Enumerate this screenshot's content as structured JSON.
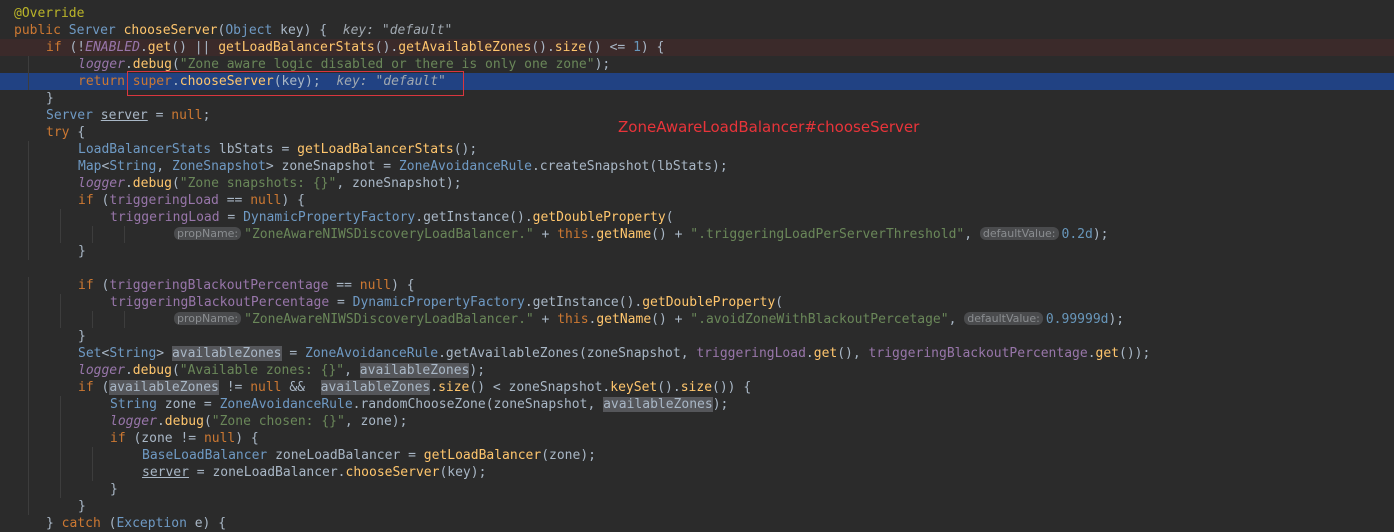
{
  "overlay": {
    "label": "ZoneAwareLoadBalancer#chooseServer"
  },
  "colors": {
    "background": "#2b2b2b",
    "current_line": "#214283",
    "error_line": "#3b2a2a",
    "annotation_red": "#e8343a"
  },
  "lines": [
    {
      "state": "",
      "indent": 0,
      "tokens": [
        {
          "t": "@Override",
          "c": "ann"
        }
      ]
    },
    {
      "state": "",
      "indent": 0,
      "tokens": [
        {
          "t": "public ",
          "c": "kw"
        },
        {
          "t": "Server ",
          "c": "cls"
        },
        {
          "t": "chooseServer",
          "c": "mth"
        },
        {
          "t": "(",
          "c": ""
        },
        {
          "t": "Object ",
          "c": "cls"
        },
        {
          "t": "key) {  ",
          "c": ""
        },
        {
          "t": "key: \"default\"",
          "c": "hint"
        }
      ]
    },
    {
      "state": "error",
      "indent": 1,
      "tokens": [
        {
          "t": "if ",
          "c": "kw"
        },
        {
          "t": "(!",
          "c": ""
        },
        {
          "t": "ENABLED",
          "c": "sfi"
        },
        {
          "t": ".",
          "c": ""
        },
        {
          "t": "get",
          "c": "mth"
        },
        {
          "t": "() || ",
          "c": ""
        },
        {
          "t": "getLoadBalancerStats",
          "c": "mth"
        },
        {
          "t": "().",
          "c": ""
        },
        {
          "t": "getAvailableZones",
          "c": "mth"
        },
        {
          "t": "().",
          "c": ""
        },
        {
          "t": "size",
          "c": "mth"
        },
        {
          "t": "() <= ",
          "c": ""
        },
        {
          "t": "1",
          "c": "num"
        },
        {
          "t": ") {",
          "c": ""
        }
      ]
    },
    {
      "state": "",
      "indent": 2,
      "tokens": [
        {
          "t": "logger",
          "c": "fldi"
        },
        {
          "t": ".",
          "c": ""
        },
        {
          "t": "debug",
          "c": "mth"
        },
        {
          "t": "(",
          "c": ""
        },
        {
          "t": "\"Zone aware logic disabled or there is only one zone\"",
          "c": "str"
        },
        {
          "t": ");",
          "c": ""
        }
      ]
    },
    {
      "state": "current",
      "indent": 2,
      "tokens": [
        {
          "t": "return ",
          "c": "kw"
        },
        {
          "t": "super",
          "c": "kw"
        },
        {
          "t": ".",
          "c": ""
        },
        {
          "t": "chooseServer",
          "c": "mth"
        },
        {
          "t": "(key);  ",
          "c": ""
        },
        {
          "t": "key: \"default\"",
          "c": "hint"
        }
      ]
    },
    {
      "state": "",
      "indent": 1,
      "tokens": [
        {
          "t": "}",
          "c": ""
        }
      ]
    },
    {
      "state": "",
      "indent": 1,
      "tokens": [
        {
          "t": "Server ",
          "c": "cls"
        },
        {
          "t": "server",
          "c": "ul"
        },
        {
          "t": " = ",
          "c": ""
        },
        {
          "t": "null",
          "c": "kw"
        },
        {
          "t": ";",
          "c": ""
        }
      ]
    },
    {
      "state": "",
      "indent": 1,
      "tokens": [
        {
          "t": "try ",
          "c": "kw"
        },
        {
          "t": "{",
          "c": ""
        }
      ]
    },
    {
      "state": "",
      "indent": 2,
      "tokens": [
        {
          "t": "LoadBalancerStats ",
          "c": "cls"
        },
        {
          "t": "lbStats = ",
          "c": ""
        },
        {
          "t": "getLoadBalancerStats",
          "c": "mth"
        },
        {
          "t": "();",
          "c": ""
        }
      ]
    },
    {
      "state": "",
      "indent": 2,
      "tokens": [
        {
          "t": "Map",
          "c": "cls"
        },
        {
          "t": "<",
          "c": ""
        },
        {
          "t": "String",
          "c": "cls"
        },
        {
          "t": ", ",
          "c": ""
        },
        {
          "t": "ZoneSnapshot",
          "c": "cls"
        },
        {
          "t": "> zoneSnapshot = ",
          "c": ""
        },
        {
          "t": "ZoneAvoidanceRule",
          "c": "cls"
        },
        {
          "t": ".createSnapshot(lbStats);",
          "c": ""
        }
      ]
    },
    {
      "state": "",
      "indent": 2,
      "tokens": [
        {
          "t": "logger",
          "c": "fldi"
        },
        {
          "t": ".",
          "c": ""
        },
        {
          "t": "debug",
          "c": "mth"
        },
        {
          "t": "(",
          "c": ""
        },
        {
          "t": "\"Zone snapshots: {}\"",
          "c": "str"
        },
        {
          "t": ", zoneSnapshot);",
          "c": ""
        }
      ]
    },
    {
      "state": "",
      "indent": 2,
      "tokens": [
        {
          "t": "if ",
          "c": "kw"
        },
        {
          "t": "(",
          "c": ""
        },
        {
          "t": "triggeringLoad",
          "c": "fld"
        },
        {
          "t": " == ",
          "c": ""
        },
        {
          "t": "null",
          "c": "kw"
        },
        {
          "t": ") {",
          "c": ""
        }
      ]
    },
    {
      "state": "",
      "indent": 3,
      "tokens": [
        {
          "t": "triggeringLoad",
          "c": "fld"
        },
        {
          "t": " = ",
          "c": ""
        },
        {
          "t": "DynamicPropertyFactory",
          "c": "cls"
        },
        {
          "t": ".getInstance().",
          "c": ""
        },
        {
          "t": "getDoubleProperty",
          "c": "mth"
        },
        {
          "t": "(",
          "c": ""
        }
      ]
    },
    {
      "state": "",
      "indent": 5,
      "tokens": [
        {
          "t": "propName:",
          "c": "chip"
        },
        {
          "t": "\"ZoneAwareNIWSDiscoveryLoadBalancer.\"",
          "c": "str"
        },
        {
          "t": " + ",
          "c": ""
        },
        {
          "t": "this",
          "c": "kw"
        },
        {
          "t": ".",
          "c": ""
        },
        {
          "t": "getName",
          "c": "mth"
        },
        {
          "t": "() + ",
          "c": ""
        },
        {
          "t": "\".triggeringLoadPerServerThreshold\"",
          "c": "str"
        },
        {
          "t": ", ",
          "c": ""
        },
        {
          "t": "defaultValue:",
          "c": "chip"
        },
        {
          "t": "0.2d",
          "c": "num"
        },
        {
          "t": ");",
          "c": ""
        }
      ]
    },
    {
      "state": "",
      "indent": 2,
      "tokens": [
        {
          "t": "}",
          "c": ""
        }
      ]
    },
    {
      "state": "",
      "indent": 0,
      "tokens": []
    },
    {
      "state": "",
      "indent": 2,
      "tokens": [
        {
          "t": "if ",
          "c": "kw"
        },
        {
          "t": "(",
          "c": ""
        },
        {
          "t": "triggeringBlackoutPercentage",
          "c": "fld"
        },
        {
          "t": " == ",
          "c": ""
        },
        {
          "t": "null",
          "c": "kw"
        },
        {
          "t": ") {",
          "c": ""
        }
      ]
    },
    {
      "state": "",
      "indent": 3,
      "tokens": [
        {
          "t": "triggeringBlackoutPercentage",
          "c": "fld"
        },
        {
          "t": " = ",
          "c": ""
        },
        {
          "t": "DynamicPropertyFactory",
          "c": "cls"
        },
        {
          "t": ".getInstance().",
          "c": ""
        },
        {
          "t": "getDoubleProperty",
          "c": "mth"
        },
        {
          "t": "(",
          "c": ""
        }
      ]
    },
    {
      "state": "",
      "indent": 5,
      "tokens": [
        {
          "t": "propName:",
          "c": "chip"
        },
        {
          "t": "\"ZoneAwareNIWSDiscoveryLoadBalancer.\"",
          "c": "str"
        },
        {
          "t": " + ",
          "c": ""
        },
        {
          "t": "this",
          "c": "kw"
        },
        {
          "t": ".",
          "c": ""
        },
        {
          "t": "getName",
          "c": "mth"
        },
        {
          "t": "() + ",
          "c": ""
        },
        {
          "t": "\".avoidZoneWithBlackoutPercetage\"",
          "c": "str"
        },
        {
          "t": ", ",
          "c": ""
        },
        {
          "t": "defaultValue:",
          "c": "chip"
        },
        {
          "t": "0.99999d",
          "c": "num"
        },
        {
          "t": ");",
          "c": ""
        }
      ]
    },
    {
      "state": "",
      "indent": 2,
      "tokens": [
        {
          "t": "}",
          "c": ""
        }
      ]
    },
    {
      "state": "",
      "indent": 2,
      "tokens": [
        {
          "t": "Set",
          "c": "cls"
        },
        {
          "t": "<",
          "c": ""
        },
        {
          "t": "String",
          "c": "cls"
        },
        {
          "t": "> ",
          "c": ""
        },
        {
          "t": "availableZones",
          "c": "hl"
        },
        {
          "t": " = ",
          "c": ""
        },
        {
          "t": "ZoneAvoidanceRule",
          "c": "cls"
        },
        {
          "t": ".getAvailableZones(zoneSnapshot, ",
          "c": ""
        },
        {
          "t": "triggeringLoad",
          "c": "fld"
        },
        {
          "t": ".",
          "c": ""
        },
        {
          "t": "get",
          "c": "mth"
        },
        {
          "t": "(), ",
          "c": ""
        },
        {
          "t": "triggeringBlackoutPercentage",
          "c": "fld"
        },
        {
          "t": ".",
          "c": ""
        },
        {
          "t": "get",
          "c": "mth"
        },
        {
          "t": "());",
          "c": ""
        }
      ]
    },
    {
      "state": "",
      "indent": 2,
      "tokens": [
        {
          "t": "logger",
          "c": "fldi"
        },
        {
          "t": ".",
          "c": ""
        },
        {
          "t": "debug",
          "c": "mth"
        },
        {
          "t": "(",
          "c": ""
        },
        {
          "t": "\"Available zones: {}\"",
          "c": "str"
        },
        {
          "t": ", ",
          "c": ""
        },
        {
          "t": "availableZones",
          "c": "hl"
        },
        {
          "t": ");",
          "c": ""
        }
      ]
    },
    {
      "state": "",
      "indent": 2,
      "tokens": [
        {
          "t": "if ",
          "c": "kw"
        },
        {
          "t": "(",
          "c": ""
        },
        {
          "t": "availableZones",
          "c": "hl"
        },
        {
          "t": " != ",
          "c": ""
        },
        {
          "t": "null ",
          "c": "kw"
        },
        {
          "t": "&&  ",
          "c": ""
        },
        {
          "t": "availableZones",
          "c": "hl"
        },
        {
          "t": ".",
          "c": ""
        },
        {
          "t": "size",
          "c": "mth"
        },
        {
          "t": "() < zoneSnapshot.",
          "c": ""
        },
        {
          "t": "keySet",
          "c": "mth"
        },
        {
          "t": "().",
          "c": ""
        },
        {
          "t": "size",
          "c": "mth"
        },
        {
          "t": "()) {",
          "c": ""
        }
      ]
    },
    {
      "state": "",
      "indent": 3,
      "tokens": [
        {
          "t": "String ",
          "c": "cls"
        },
        {
          "t": "zone = ",
          "c": ""
        },
        {
          "t": "ZoneAvoidanceRule",
          "c": "cls"
        },
        {
          "t": ".randomChooseZone(zoneSnapshot, ",
          "c": ""
        },
        {
          "t": "availableZones",
          "c": "hl"
        },
        {
          "t": ");",
          "c": ""
        }
      ]
    },
    {
      "state": "",
      "indent": 3,
      "tokens": [
        {
          "t": "logger",
          "c": "fldi"
        },
        {
          "t": ".",
          "c": ""
        },
        {
          "t": "debug",
          "c": "mth"
        },
        {
          "t": "(",
          "c": ""
        },
        {
          "t": "\"Zone chosen: {}\"",
          "c": "str"
        },
        {
          "t": ", zone);",
          "c": ""
        }
      ]
    },
    {
      "state": "",
      "indent": 3,
      "tokens": [
        {
          "t": "if ",
          "c": "kw"
        },
        {
          "t": "(zone != ",
          "c": ""
        },
        {
          "t": "null",
          "c": "kw"
        },
        {
          "t": ") {",
          "c": ""
        }
      ]
    },
    {
      "state": "",
      "indent": 4,
      "tokens": [
        {
          "t": "BaseLoadBalancer ",
          "c": "cls"
        },
        {
          "t": "zoneLoadBalancer = ",
          "c": ""
        },
        {
          "t": "getLoadBalancer",
          "c": "mth"
        },
        {
          "t": "(zone);",
          "c": ""
        }
      ]
    },
    {
      "state": "",
      "indent": 4,
      "tokens": [
        {
          "t": "server",
          "c": "ul"
        },
        {
          "t": " = zoneLoadBalancer.",
          "c": ""
        },
        {
          "t": "chooseServer",
          "c": "mth"
        },
        {
          "t": "(key);",
          "c": ""
        }
      ]
    },
    {
      "state": "",
      "indent": 3,
      "tokens": [
        {
          "t": "}",
          "c": ""
        }
      ]
    },
    {
      "state": "",
      "indent": 2,
      "tokens": [
        {
          "t": "}",
          "c": ""
        }
      ]
    },
    {
      "state": "",
      "indent": 1,
      "tokens": [
        {
          "t": "} ",
          "c": ""
        },
        {
          "t": "catch ",
          "c": "kw"
        },
        {
          "t": "(",
          "c": ""
        },
        {
          "t": "Exception ",
          "c": "cls"
        },
        {
          "t": "e) {",
          "c": ""
        }
      ]
    }
  ]
}
